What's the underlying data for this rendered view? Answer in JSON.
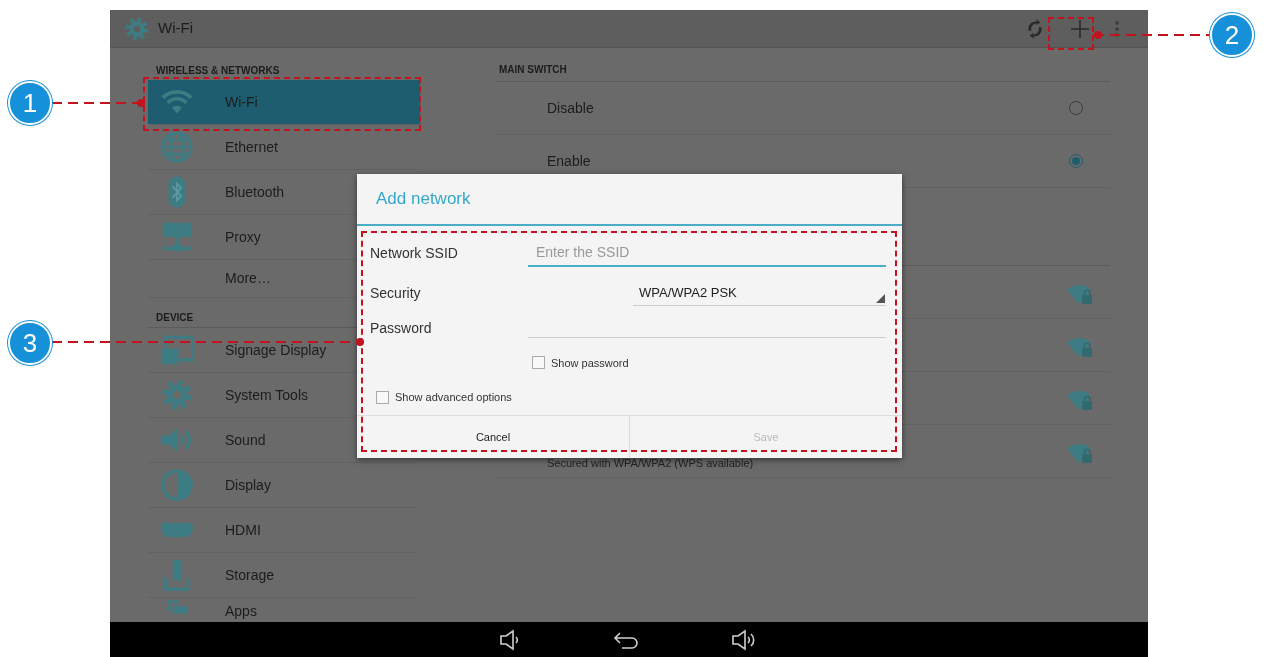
{
  "action_bar": {
    "title": "Wi-Fi"
  },
  "sidebar": [
    {
      "header": "WIRELESS & NETWORKS",
      "items": [
        {
          "label": "Wi-Fi",
          "selected": true
        },
        {
          "label": "Ethernet",
          "selected": false
        },
        {
          "label": "Bluetooth",
          "selected": false
        },
        {
          "label": "Proxy",
          "selected": false
        },
        {
          "label": "More…",
          "selected": false
        }
      ]
    },
    {
      "header": "DEVICE",
      "items": [
        {
          "label": "Signage Display",
          "selected": false
        },
        {
          "label": "System Tools",
          "selected": false
        },
        {
          "label": "Sound",
          "selected": false
        },
        {
          "label": "Display",
          "selected": false
        },
        {
          "label": "HDMI",
          "selected": false
        },
        {
          "label": "Storage",
          "selected": false
        },
        {
          "label": "Apps",
          "selected": false
        }
      ]
    }
  ],
  "main_switch": {
    "header": "MAIN SWITCH",
    "options": [
      {
        "label": "Disable",
        "selected": false
      },
      {
        "label": "Enable",
        "selected": true
      }
    ]
  },
  "networks": [
    {
      "secured": true
    },
    {
      "secured": true
    },
    {
      "secured": true
    },
    {
      "secured": true,
      "status": "Secured with WPA/WPA2 (WPS available)"
    }
  ],
  "dialog": {
    "title": "Add network",
    "ssid": {
      "label": "Network SSID",
      "placeholder": "Enter the SSID"
    },
    "security": {
      "label": "Security",
      "value": "WPA/WPA2 PSK"
    },
    "password": {
      "label": "Password"
    },
    "show_password": {
      "label": "Show password",
      "checked": false
    },
    "advanced": {
      "label": "Show advanced options",
      "checked": false
    },
    "buttons": [
      {
        "label": "Cancel",
        "disabled": false
      },
      {
        "label": "Save",
        "disabled": true
      }
    ]
  },
  "callouts": [
    {
      "number": "1"
    },
    {
      "number": "2"
    },
    {
      "number": "3"
    }
  ]
}
